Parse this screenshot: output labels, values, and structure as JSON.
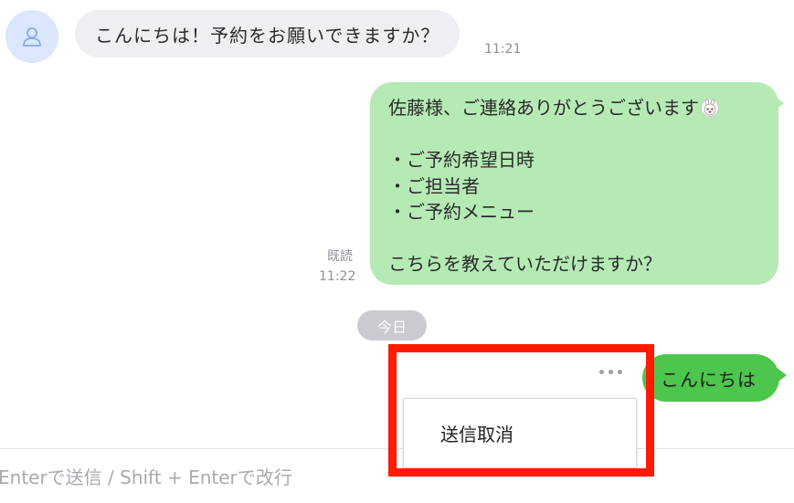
{
  "incoming": {
    "message": "こんにちは！予約をお願いできますか？",
    "time": "11:21"
  },
  "outgoing": {
    "lines": [
      "佐藤様、ご連絡ありがとうございます",
      "",
      "・ご予約希望日時",
      "・ご担当者",
      "・ご予約メニュー",
      "",
      "こちらを教えていただけますか？"
    ],
    "emoji_icon": "rabbit-face-icon",
    "read_status": "既読",
    "time": "11:22"
  },
  "date_separator": "今日",
  "latest_message": {
    "text": "こんにちは",
    "more_icon": "more-dots-icon"
  },
  "context_menu": {
    "items": [
      "送信取消"
    ]
  },
  "composer": {
    "placeholder": "Enterで送信 / Shift + Enterで改行"
  },
  "colors": {
    "incoming_bubble": "#eeeff2",
    "outgoing_bubble": "#b6eab5",
    "latest_bubble": "#4cc64c",
    "highlight": "#ff1a00",
    "avatar_bg": "#dbe6ff"
  }
}
